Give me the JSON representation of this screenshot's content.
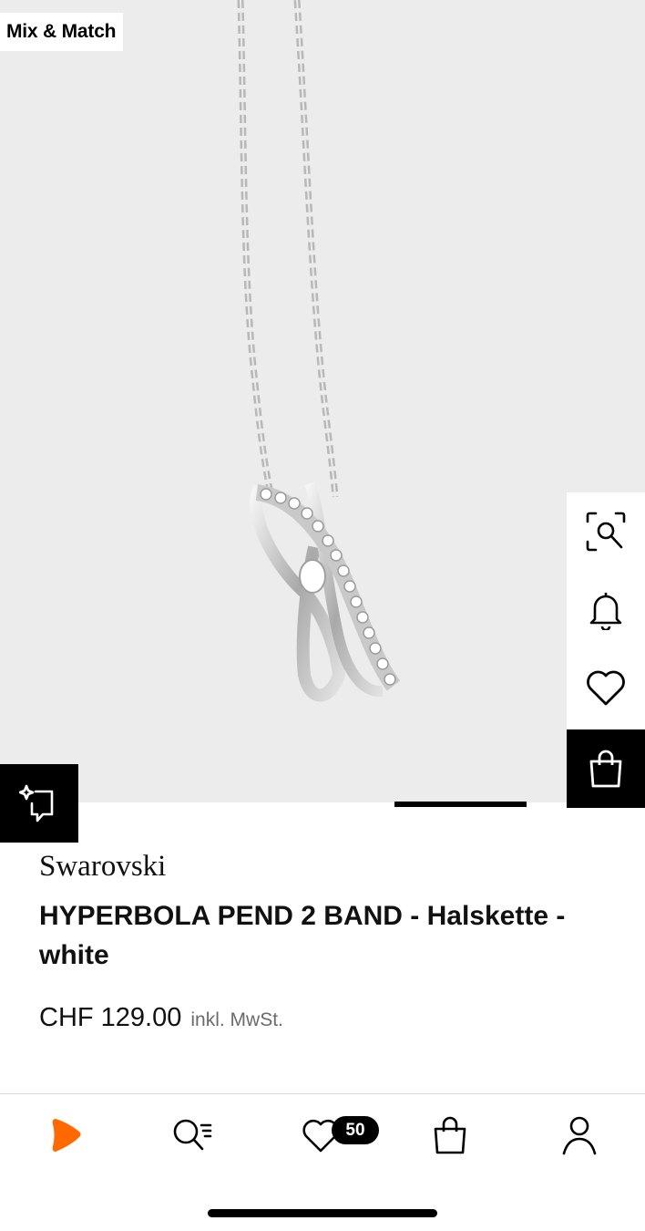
{
  "hero": {
    "badge_label": "Mix & Match",
    "image_alt": "Silver necklace with crossed crystal band pendant"
  },
  "side_actions": {
    "items": [
      "visual-search-icon",
      "bell-icon",
      "heart-icon",
      "shopping-bag-icon"
    ]
  },
  "product": {
    "brand": "Swarovski",
    "title": "HYPERBOLA PEND 2 BAND - Halskette - white",
    "price": "CHF 129.00",
    "vat_note": "inkl. MwSt."
  },
  "tabbar": {
    "items": [
      "zalando-home-icon",
      "search-icon",
      "wishlist-icon",
      "bag-icon",
      "account-icon"
    ],
    "wishlist_count": "50"
  },
  "colors": {
    "accent": "#ff6900",
    "hero_background": "#ececec",
    "black": "#000000"
  }
}
